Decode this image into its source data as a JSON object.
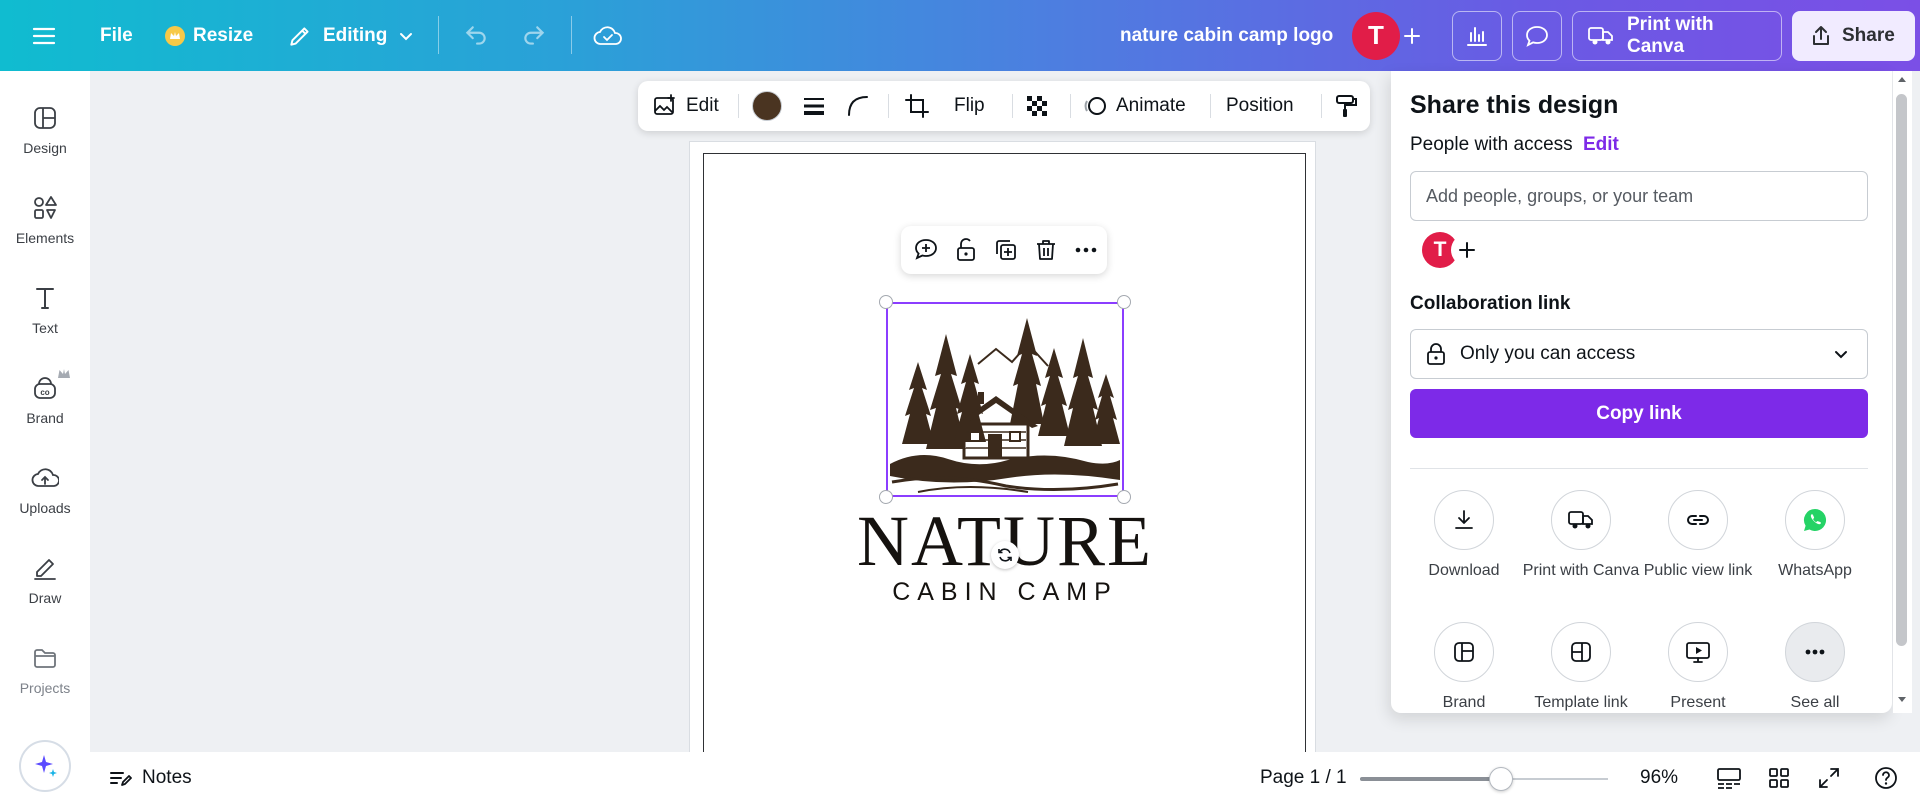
{
  "topbar": {
    "file_label": "File",
    "resize_label": "Resize",
    "editing_label": "Editing",
    "doc_title": "nature cabin camp logo",
    "avatar_initial": "T",
    "print_label": "Print with Canva",
    "share_label": "Share"
  },
  "sidebar": {
    "items": [
      {
        "label": "Design",
        "icon": "design-icon"
      },
      {
        "label": "Elements",
        "icon": "elements-icon"
      },
      {
        "label": "Text",
        "icon": "text-icon"
      },
      {
        "label": "Brand",
        "icon": "brand-icon"
      },
      {
        "label": "Uploads",
        "icon": "uploads-icon"
      },
      {
        "label": "Draw",
        "icon": "draw-icon"
      },
      {
        "label": "Projects",
        "icon": "projects-icon"
      }
    ]
  },
  "context_toolbar": {
    "edit_label": "Edit",
    "color_swatch": "#4a3421",
    "flip_label": "Flip",
    "animate_label": "Animate",
    "position_label": "Position"
  },
  "design": {
    "title": "NATURE",
    "subtitle": "CABIN CAMP",
    "ink_color": "#3b2a1c"
  },
  "share_panel": {
    "title": "Share this design",
    "people_label": "People with access",
    "edit_link": "Edit",
    "add_placeholder": "Add people, groups, or your team",
    "avatar_initial": "T",
    "collab_label": "Collaboration link",
    "access_value": "Only you can access",
    "copy_label": "Copy link",
    "options": [
      {
        "label": "Download",
        "icon": "download-icon"
      },
      {
        "label": "Print with Canva",
        "icon": "truck-icon"
      },
      {
        "label": "Public view link",
        "icon": "link-icon"
      },
      {
        "label": "WhatsApp",
        "icon": "whatsapp-icon"
      },
      {
        "label": "Brand",
        "icon": "brand-template-icon"
      },
      {
        "label": "Template link",
        "icon": "template-icon"
      },
      {
        "label": "Present",
        "icon": "present-icon"
      },
      {
        "label": "See all",
        "icon": "more-icon"
      }
    ]
  },
  "bottombar": {
    "notes_label": "Notes",
    "page_indicator": "Page 1 / 1",
    "zoom_label": "96%",
    "zoom_level": 0.57
  },
  "colors": {
    "accent": "#7d2ae8",
    "avatar": "#e11d48",
    "whatsapp": "#25d366"
  }
}
